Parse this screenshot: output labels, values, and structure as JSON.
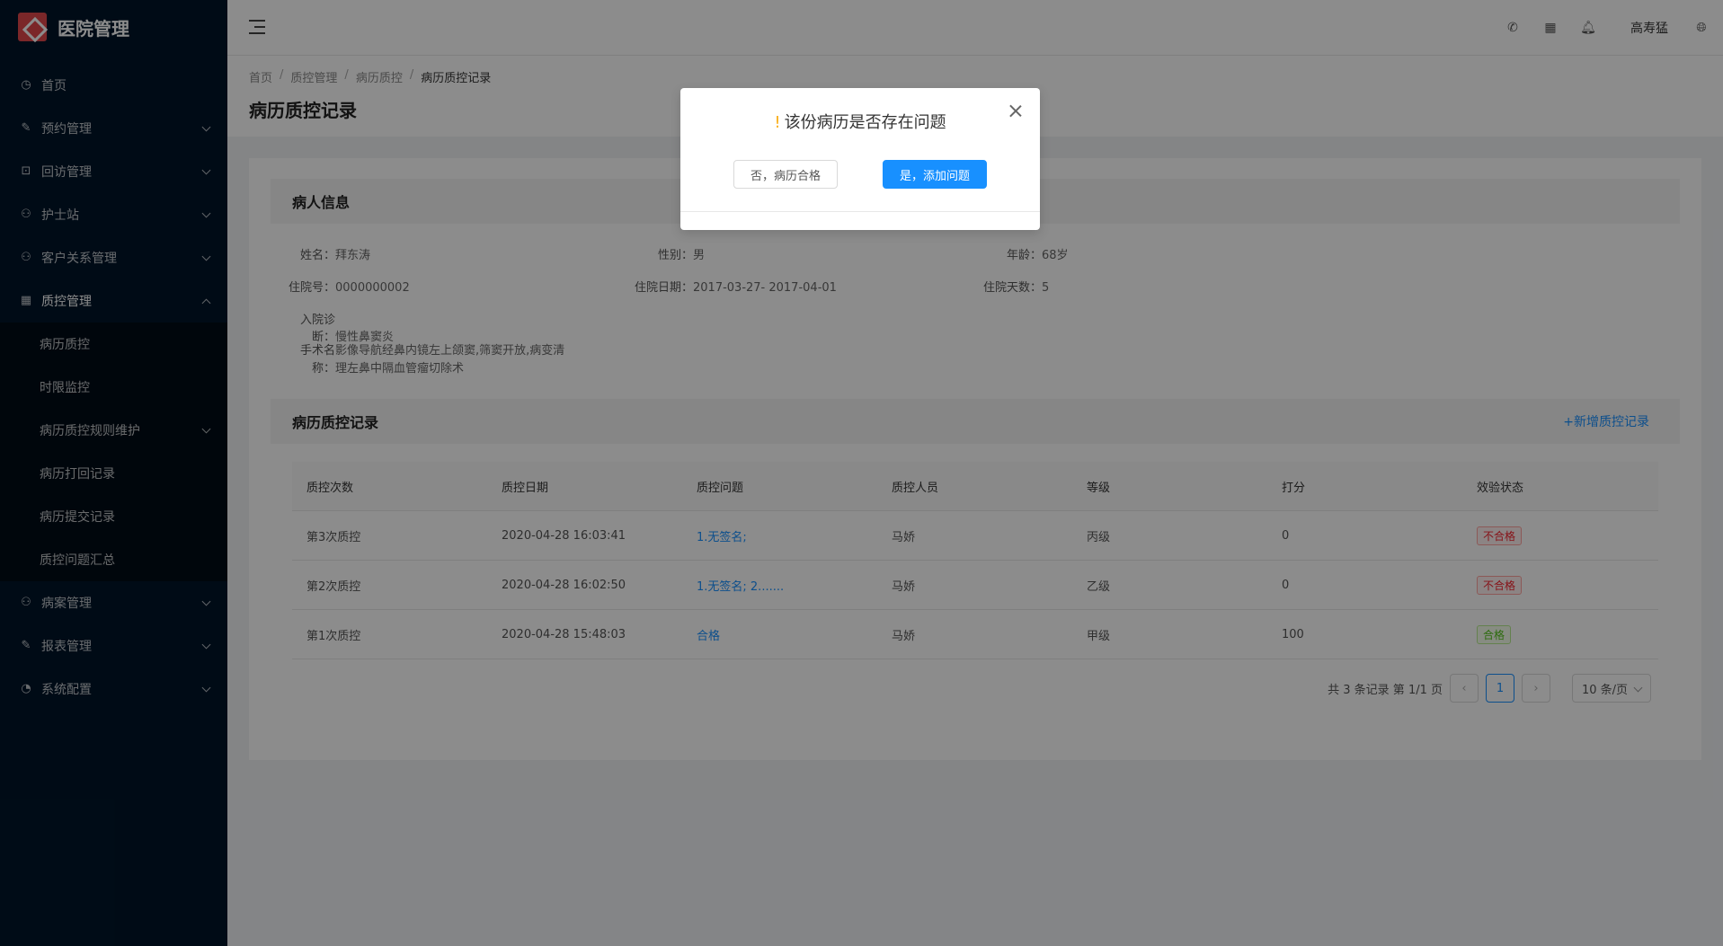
{
  "app": {
    "title": "医院管理"
  },
  "sidebar": {
    "items": [
      {
        "label": "首页",
        "icon": "clock-icon"
      },
      {
        "label": "预约管理",
        "icon": "edit-icon"
      },
      {
        "label": "回访管理",
        "icon": "lock-icon"
      },
      {
        "label": "护士站",
        "icon": "user-icon"
      },
      {
        "label": "客户关系管理",
        "icon": "user-icon"
      },
      {
        "label": "质控管理",
        "icon": "table-icon"
      },
      {
        "label": "病案管理",
        "icon": "user-icon"
      },
      {
        "label": "报表管理",
        "icon": "edit-icon"
      },
      {
        "label": "系统配置",
        "icon": "dashboard-icon"
      }
    ],
    "submenu": [
      {
        "label": "病历质控"
      },
      {
        "label": "时限监控"
      },
      {
        "label": "病历质控规则维护"
      },
      {
        "label": "病历打回记录"
      },
      {
        "label": "病历提交记录"
      },
      {
        "label": "质控问题汇总"
      }
    ]
  },
  "header": {
    "user": "高寿猛"
  },
  "breadcrumb": [
    "首页",
    "质控管理",
    "病历质控",
    "病历质控记录"
  ],
  "page_title": "病历质控记录",
  "patient": {
    "section_title": "病人信息",
    "name_label": "姓名：",
    "name": "拜东涛",
    "gender_label": "性别：",
    "gender": "男",
    "age_label": "年龄：",
    "age": "68岁",
    "admission_no_label": "住院号：",
    "admission_no": "0000000002",
    "stay_dates_label": "住院日期：",
    "stay_dates": "2017-03-27- 2017-04-01",
    "stay_days_label": "住院天数：",
    "stay_days": "5",
    "diagnosis_label": "入院诊断：",
    "diagnosis": "慢性鼻窦炎",
    "surgery_label": "手术名称：",
    "surgery_line1": "影像导航经鼻内镜左上颌窦,筛窦开放,病变清",
    "surgery_line2": "理左鼻中隔血管瘤切除术"
  },
  "records": {
    "section_title": "病历质控记录",
    "add_label": "+新增质控记录",
    "columns": [
      "质控次数",
      "质控日期",
      "质控问题",
      "质控人员",
      "等级",
      "打分",
      "效验状态"
    ],
    "rows": [
      {
        "times": "第3次质控",
        "date": "2020-04-28 16:03:41",
        "issue": "1.无签名;",
        "staff": "马娇",
        "grade": "丙级",
        "score": "0",
        "status": "不合格"
      },
      {
        "times": "第2次质控",
        "date": "2020-04-28 16:02:50",
        "issue": "1.无签名; 2.......",
        "staff": "马娇",
        "grade": "乙级",
        "score": "0",
        "status": "不合格"
      },
      {
        "times": "第1次质控",
        "date": "2020-04-28 15:48:03",
        "issue": "合格",
        "staff": "马娇",
        "grade": "甲级",
        "score": "100",
        "status": "合格"
      }
    ]
  },
  "pagination": {
    "summary": "共 3 条记录 第 1/1 页",
    "current": "1",
    "page_size": "10 条/页"
  },
  "modal": {
    "warn_mark": "!",
    "title": "该份病历是否存在问题",
    "no_label": "否，病历合格",
    "yes_label": "是，添加问题"
  }
}
